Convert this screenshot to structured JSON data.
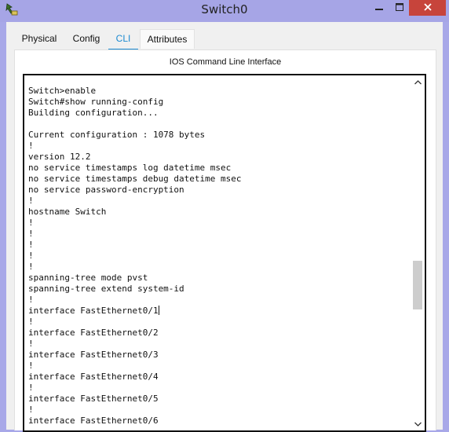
{
  "window": {
    "title": "Switch0"
  },
  "tabs": [
    {
      "label": "Physical"
    },
    {
      "label": "Config"
    },
    {
      "label": "CLI"
    },
    {
      "label": "Attributes"
    }
  ],
  "active_tab": "CLI",
  "panel": {
    "title": "IOS Command Line Interface"
  },
  "terminal": {
    "lines": [
      "Switch>enable",
      "Switch#show running-config",
      "Building configuration...",
      "",
      "Current configuration : 1078 bytes",
      "!",
      "version 12.2",
      "no service timestamps log datetime msec",
      "no service timestamps debug datetime msec",
      "no service password-encryption",
      "!",
      "hostname Switch",
      "!",
      "!",
      "!",
      "!",
      "!",
      "spanning-tree mode pvst",
      "spanning-tree extend system-id",
      "!",
      "interface FastEthernet0/1",
      "!",
      "interface FastEthernet0/2",
      "!",
      "interface FastEthernet0/3",
      "!",
      "interface FastEthernet0/4",
      "!",
      "interface FastEthernet0/5",
      "!",
      "interface FastEthernet0/6"
    ]
  },
  "icons": {
    "app": "cisco-device-icon",
    "minimize": "minimize-icon",
    "maximize": "maximize-icon",
    "close": "close-icon",
    "scroll_up": "chevron-up-icon",
    "scroll_down": "chevron-down-icon"
  },
  "colors": {
    "titlebar": "#a6a5e6",
    "close_button": "#c7443b",
    "active_tab": "#1b8ad1"
  }
}
